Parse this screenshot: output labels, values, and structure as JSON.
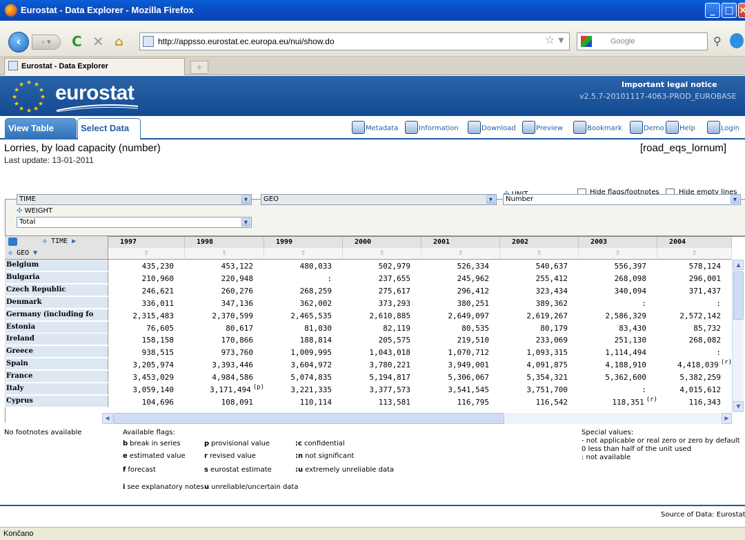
{
  "window": {
    "title": "Eurostat - Data Explorer - Mozilla Firefox"
  },
  "browser": {
    "url": "http://appsso.eurostat.ec.europa.eu/nui/show.do",
    "search_placeholder": "Google",
    "tab_title": "Eurostat - Data Explorer",
    "new_tab_label": "+",
    "status": "Končano"
  },
  "header": {
    "logo_text": "eurostat",
    "legal_notice": "Important legal notice",
    "version": "v2.5.7-20101117-4063-PROD_EUROBASE"
  },
  "app_tabs": {
    "view_table": "View Table",
    "select_data": "Select Data"
  },
  "toolbar": [
    "Metadata",
    "Information",
    "Download",
    "Preview",
    "Bookmark",
    "Demo",
    "Help",
    "Login"
  ],
  "page": {
    "title": "Lorries, by load capacity (number)",
    "code": "[road_eqs_lornum]",
    "last_update": "Last update: 13-01-2011",
    "hide_flags_label": "Hide flags/footnotes",
    "hide_empty_label": "Hide empty lines"
  },
  "dimensions": {
    "unit_label": "UNIT",
    "weight_label": "WEIGHT",
    "time_select": "TIME",
    "geo_select": "GEO",
    "unit_value": "Number",
    "weight_value": "Total"
  },
  "table": {
    "time_label": "TIME",
    "geo_label": "GEO",
    "years": [
      "1997",
      "1998",
      "1999",
      "2000",
      "2001",
      "2002",
      "2003",
      "2004"
    ],
    "rows": [
      {
        "country": "Belgium",
        "values": [
          "435,230",
          "453,122",
          "480,033",
          "502,979",
          "526,334",
          "540,637",
          "556,397",
          "578,124"
        ]
      },
      {
        "country": "Bulgaria",
        "values": [
          "210,960",
          "220,948",
          ":",
          "237,655",
          "245,962",
          "255,412",
          "268,098",
          "296,001"
        ]
      },
      {
        "country": "Czech Republic",
        "values": [
          "246,621",
          "260,276",
          "268,259",
          "275,617",
          "296,412",
          "323,434",
          "340,094",
          "371,437"
        ]
      },
      {
        "country": "Denmark",
        "values": [
          "336,011",
          "347,136",
          "362,002",
          "373,293",
          "380,251",
          "389,362",
          ":",
          ":"
        ]
      },
      {
        "country": "Germany (including fo",
        "values": [
          "2,315,483",
          "2,370,599",
          "2,465,535",
          "2,610,885",
          "2,649,097",
          "2,619,267",
          "2,586,329",
          "2,572,142"
        ]
      },
      {
        "country": "Estonia",
        "values": [
          "76,605",
          "80,617",
          "81,030",
          "82,119",
          "80,535",
          "80,179",
          "83,430",
          "85,732"
        ]
      },
      {
        "country": "Ireland",
        "values": [
          "158,158",
          "170,866",
          "188,814",
          "205,575",
          "219,510",
          "233,069",
          "251,130",
          "268,082"
        ]
      },
      {
        "country": "Greece",
        "values": [
          "938,515",
          "973,760",
          "1,009,995",
          "1,043,018",
          "1,070,712",
          "1,093,315",
          "1,114,494",
          ":"
        ]
      },
      {
        "country": "Spain",
        "values": [
          "3,205,974",
          "3,393,446",
          "3,604,972",
          "3,780,221",
          "3,949,001",
          "4,091,875",
          "4,188,910",
          "4,418,039"
        ],
        "flags": [
          "",
          "",
          "",
          "",
          "",
          "",
          "",
          "(r)"
        ]
      },
      {
        "country": "France",
        "values": [
          "3,453,029",
          "4,984,586",
          "5,074,835",
          "5,194,817",
          "5,306,067",
          "5,354,321",
          "5,362,600",
          "5,382,259"
        ]
      },
      {
        "country": "Italy",
        "values": [
          "3,059,140",
          "3,171,494",
          "3,221,335",
          "3,377,573",
          "3,541,545",
          "3,751,700",
          ":",
          "4,015,612"
        ],
        "flags": [
          "",
          "(p)",
          "",
          "",
          "",
          "",
          "",
          ""
        ]
      },
      {
        "country": "Cyprus",
        "values": [
          "104,696",
          "108,091",
          "110,114",
          "113,581",
          "116,795",
          "116,542",
          "118,351",
          "116,343"
        ],
        "flags": [
          "",
          "",
          "",
          "",
          "",
          "",
          "(r)",
          ""
        ]
      }
    ]
  },
  "footer": {
    "no_footnotes": "No footnotes available",
    "flags_title": "Available flags:",
    "flags": [
      {
        "key": "b",
        "text": "break in series"
      },
      {
        "key": "p",
        "text": "provisional value"
      },
      {
        "key": ":c",
        "text": "confidential"
      },
      {
        "key": "e",
        "text": "estimated value"
      },
      {
        "key": "r",
        "text": "revised value"
      },
      {
        "key": ":n",
        "text": "not significant"
      },
      {
        "key": "f",
        "text": "forecast"
      },
      {
        "key": "s",
        "text": "eurostat estimate"
      },
      {
        "key": ":u",
        "text": "extremely unreliable data"
      },
      {
        "key": "i",
        "text": "see explanatory notes"
      },
      {
        "key": "u",
        "text": "unreliable/uncertain data"
      }
    ],
    "special_title": "Special values:",
    "special": [
      "- not applicable or real zero or zero by default",
      "0 less than half of the unit used",
      ": not available"
    ],
    "source": "Source of Data: Eurostat"
  },
  "colors": {
    "eurostat_blue": "#134b92",
    "link_blue": "#1d5fa5",
    "row_header": "#dde7f2"
  }
}
